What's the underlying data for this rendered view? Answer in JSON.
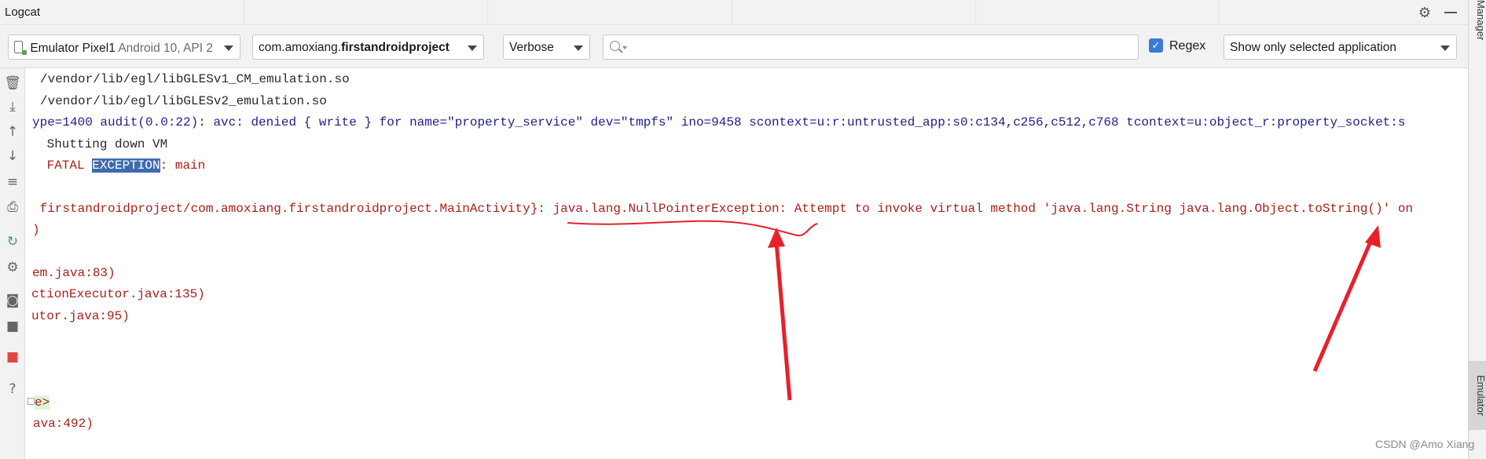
{
  "window": {
    "title": "Logcat"
  },
  "toolbar": {
    "device": {
      "name": "Emulator Pixel1",
      "detail": "Android 10, API 2"
    },
    "package": {
      "prefix": "com.amoxiang.",
      "bold": "firstandroidproject"
    },
    "level": "Verbose",
    "search": {
      "value": "",
      "placeholder": ""
    },
    "regex": {
      "label": "Regex",
      "checked": true
    },
    "filter": "Show only selected application"
  },
  "right_strip": {
    "tabs": [
      "Manager",
      "Emulator"
    ]
  },
  "left_strip": {
    "tools": [
      "trash-icon",
      "scroll-to-end-icon",
      "arrow-up-icon",
      "arrow-down-icon",
      "soft-wrap-icon",
      "print-icon",
      "restart-icon",
      "settings-icon",
      "camera-icon",
      "video-icon",
      "stop-icon",
      "help-icon"
    ]
  },
  "log": {
    "l1": "/vendor/lib/egl/libGLESv1_CM_emulation.so",
    "l2": "/vendor/lib/egl/libGLESv2_emulation.so",
    "l3": "ype=1400 audit(0.0:22): avc: denied { write } for name=\"property_service\" dev=\"tmpfs\" ino=9458 scontext=u:r:untrusted_app:s0:c134,c256,c512,c768 tcontext=u:object_r:property_socket:s",
    "l4": " Shutting down VM",
    "l5_a": " FATAL ",
    "l5_hl": "EXCEPTION",
    "l5_b": ": main",
    "l6": " firstandroidproject/com.amoxiang.firstandroidproject.MainActivity}: java.lang.NullPointerException: Attempt to invoke virtual method 'java.lang.String java.lang.Object.toString()' on",
    "l7": ")",
    "l8": "em.java:83)",
    "l9": "ctionExecutor.java:135)",
    "l10": "utor.java:95)",
    "l11": "e>",
    "l12": "ava:492)"
  },
  "watermark": "CSDN @Amo Xiang",
  "colors": {
    "annotation": "#e8202a",
    "selection": "#3e6bb0",
    "log_red": "#a8201a",
    "log_blue": "#1e1e8a"
  }
}
